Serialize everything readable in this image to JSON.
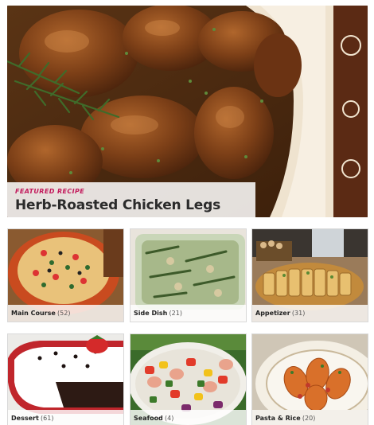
{
  "featured": {
    "kicker": "FEATURED RECIPE",
    "title": "Herb-Roasted Chicken Legs"
  },
  "categories": [
    {
      "name": "Main Course",
      "count": "(52)"
    },
    {
      "name": "Side Dish",
      "count": "(21)"
    },
    {
      "name": "Appetizer",
      "count": "(31)"
    },
    {
      "name": "Dessert",
      "count": "(61)"
    },
    {
      "name": "Seafood",
      "count": "(4)"
    },
    {
      "name": "Pasta & Rice",
      "count": "(20)"
    }
  ],
  "colors": {
    "kicker_accent": "#c2185b",
    "title_text": "#2b2b2b"
  }
}
